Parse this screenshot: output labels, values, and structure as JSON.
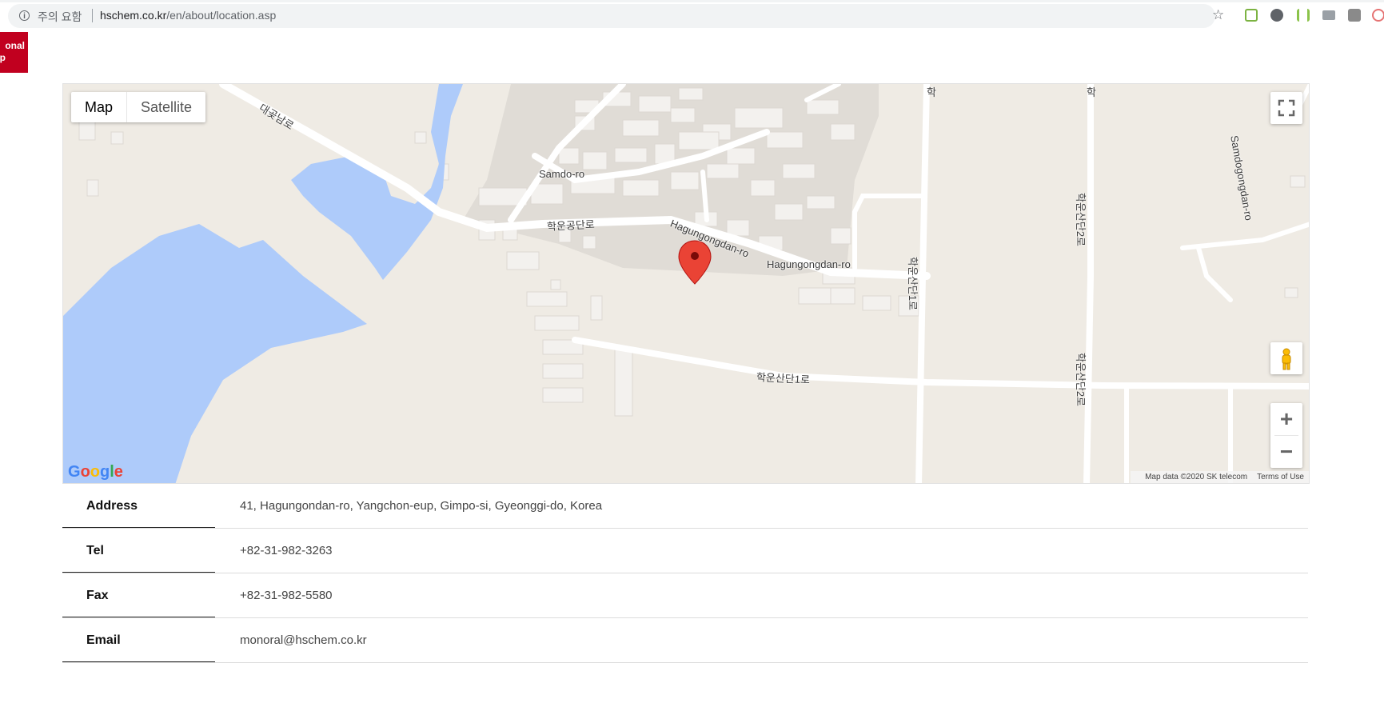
{
  "browser": {
    "security_label": "주의 요함",
    "url_host": "hschem.co.kr",
    "url_path": "/en/about/location.asp"
  },
  "brand": {
    "line1": "onal",
    "line2": "p",
    "color": "#c1001f"
  },
  "map": {
    "map_type_buttons": [
      "Map",
      "Satellite"
    ],
    "active_map_type": "Map",
    "road_labels": {
      "daegot": "대곶남로",
      "samdo": "Samdo-ro",
      "hakun_gongdan": "학운공단로",
      "hagungongdan_curved": "Hagungongdan-ro",
      "hagungongdan": "Hagungongdan-ro",
      "hakun_sandan1": "학운산단1로",
      "hakun_sandan_v1": "학운산단1로",
      "hakun_sandan2": "학운산단2로",
      "hakun_sandan2_lower": "학운산단2로",
      "samdogongdan": "Samdogongdan-ro",
      "top_label1": "학",
      "top_label2": "학"
    },
    "attribution": "Map data ©2020 SK telecom",
    "terms": "Terms of Use",
    "logo": "Google",
    "icons": [
      "fullscreen-icon",
      "pegman-icon",
      "zoom-in-icon",
      "zoom-out-icon",
      "map-marker-icon"
    ],
    "colors": {
      "water": "#aecbfa",
      "land": "#efebe4",
      "industrial": "#e0dcd6",
      "marker": "#ea4335"
    }
  },
  "contact": [
    {
      "label": "Address",
      "value": "41, Hagungondan-ro, Yangchon-eup, Gimpo-si, Gyeonggi-do, Korea"
    },
    {
      "label": "Tel",
      "value": "+82-31-982-3263"
    },
    {
      "label": "Fax",
      "value": "+82-31-982-5580"
    },
    {
      "label": "Email",
      "value": "monoral@hschem.co.kr"
    }
  ]
}
